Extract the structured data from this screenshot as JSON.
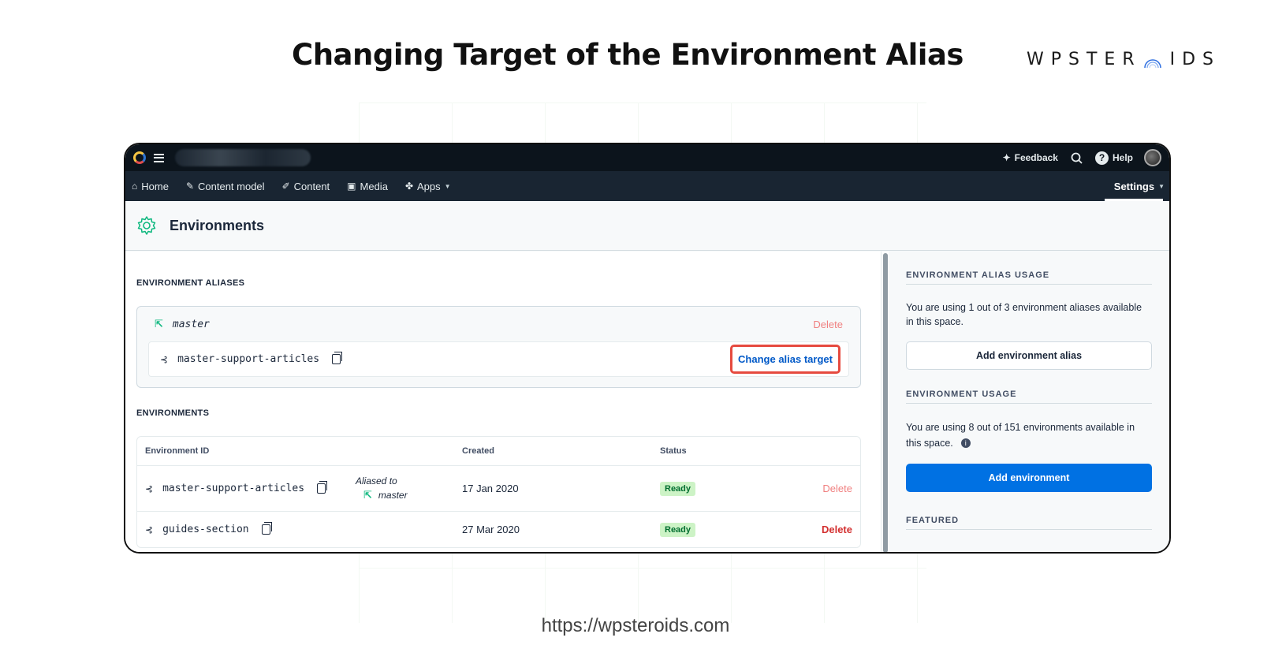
{
  "headline": "Changing Target of the Environment Alias",
  "brand": {
    "left": "WPSTER",
    "right": "IDS"
  },
  "footer_url": "https://wpsteroids.com",
  "app": {
    "topbar": {
      "feedback": "Feedback",
      "help": "Help"
    },
    "nav": {
      "items": [
        {
          "label": "Home",
          "icon": "home-icon"
        },
        {
          "label": "Content model",
          "icon": "wrench-icon"
        },
        {
          "label": "Content",
          "icon": "pen-icon"
        },
        {
          "label": "Media",
          "icon": "image-icon"
        },
        {
          "label": "Apps",
          "icon": "puzzle-icon"
        }
      ],
      "settings": "Settings"
    },
    "page_title": "Environments",
    "aliases": {
      "heading": "ENVIRONMENT ALIASES",
      "alias_name": "master",
      "delete": "Delete",
      "target": "master-support-articles",
      "change_button": "Change alias target"
    },
    "environments": {
      "heading": "ENVIRONMENTS",
      "columns": {
        "id": "Environment ID",
        "created": "Created",
        "status": "Status"
      },
      "rows": [
        {
          "id": "master-support-articles",
          "aliased_label": "Aliased to",
          "aliased_name": "master",
          "created": "17 Jan 2020",
          "status": "Ready",
          "delete": "Delete"
        },
        {
          "id": "guides-section",
          "aliased_label": "",
          "aliased_name": "",
          "created": "27 Mar 2020",
          "status": "Ready",
          "delete": "Delete"
        }
      ]
    },
    "sidebar": {
      "alias_usage": {
        "heading": "ENVIRONMENT ALIAS USAGE",
        "text": "You are using 1 out of 3 environment aliases available in this space.",
        "button": "Add environment alias"
      },
      "env_usage": {
        "heading": "ENVIRONMENT USAGE",
        "text": "You are using 8 out of 151 environments available in this space.",
        "button": "Add environment"
      },
      "featured": {
        "heading": "FEATURED"
      }
    }
  },
  "colors": {
    "accent": "#0071e3",
    "link": "#0059c8",
    "highlight": "#e64a3f",
    "ready_bg": "#cdf3c6",
    "danger": "#d32f2f"
  }
}
